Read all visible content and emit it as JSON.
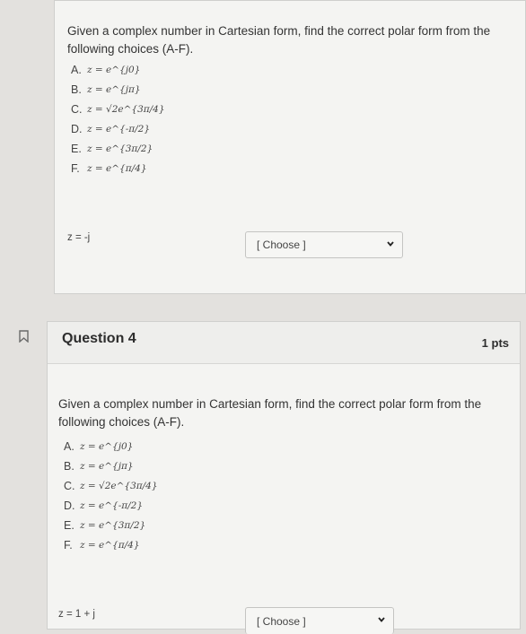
{
  "question3": {
    "prompt": "Given a complex number in Cartesian form, find the correct polar form from the following choices (A-F).",
    "choices": [
      {
        "label": "A.",
        "formula": "z = e^{j0}"
      },
      {
        "label": "B.",
        "formula": "z = e^{jπ}"
      },
      {
        "label": "C.",
        "formula": "z = √2e^{3π/4}"
      },
      {
        "label": "D.",
        "formula": "z = e^{-π/2}"
      },
      {
        "label": "E.",
        "formula": "z = e^{3π/2}"
      },
      {
        "label": "F.",
        "formula": "z = e^{π/4}"
      }
    ],
    "answer_label": "z = -j",
    "select_value": "[ Choose ]"
  },
  "question4": {
    "title": "Question 4",
    "points": "1 pts",
    "prompt": "Given a complex number in Cartesian form, find the correct polar form from the following choices (A-F).",
    "choices": [
      {
        "label": "A.",
        "formula": "z = e^{j0}"
      },
      {
        "label": "B.",
        "formula": "z = e^{jπ}"
      },
      {
        "label": "C.",
        "formula": "z = √2e^{3π/4}"
      },
      {
        "label": "D.",
        "formula": "z = e^{-π/2}"
      },
      {
        "label": "E.",
        "formula": "z = e^{3π/2}"
      },
      {
        "label": "F.",
        "formula": "z = e^{π/4}"
      }
    ],
    "answer_label": "z = 1 + j",
    "select_value": "[ Choose ]"
  },
  "icons": {
    "flag": "bookmark-flag-icon",
    "chevron": "chevron-down-icon"
  }
}
